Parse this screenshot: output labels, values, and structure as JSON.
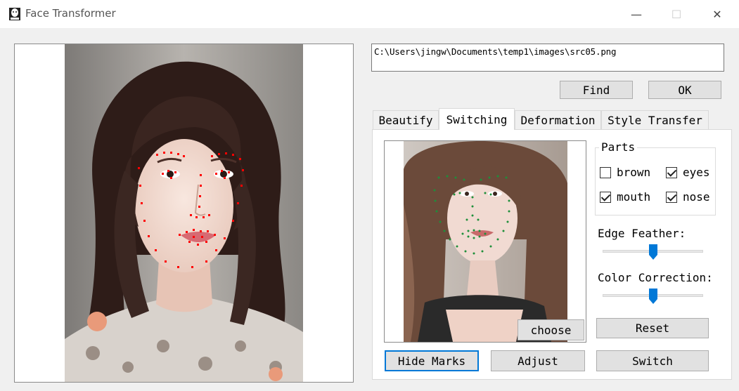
{
  "window": {
    "title": "Face Transformer",
    "minimize_glyph": "—",
    "maximize_glyph": "☐",
    "close_glyph": "✕"
  },
  "file_path": "C:\\Users\\jingw\\Documents\\temp1\\images\\src05.png",
  "buttons": {
    "find": "Find",
    "ok": "OK",
    "choose": "choose",
    "reset": "Reset",
    "hide_marks": "Hide Marks",
    "adjust": "Adjust",
    "switch": "Switch"
  },
  "tabs": [
    {
      "label": "Beautify",
      "active": false
    },
    {
      "label": "Switching",
      "active": true
    },
    {
      "label": "Deformation",
      "active": false
    },
    {
      "label": "Style Transfer",
      "active": false
    }
  ],
  "parts": {
    "title": "Parts",
    "items": [
      {
        "label": "brown",
        "checked": false
      },
      {
        "label": "eyes",
        "checked": true
      },
      {
        "label": "mouth",
        "checked": true
      },
      {
        "label": "nose",
        "checked": true
      }
    ]
  },
  "sliders": {
    "edge_feather": {
      "label": "Edge Feather:",
      "value": 0.5
    },
    "color_correction": {
      "label": "Color Correction:",
      "value": 0.5
    }
  },
  "colors": {
    "accent": "#0078d7",
    "landmark_main": "#ff0000",
    "landmark_thumb": "#1e8f3a",
    "background": "#f0f0f0"
  },
  "icons": {
    "app": "face-icon"
  }
}
